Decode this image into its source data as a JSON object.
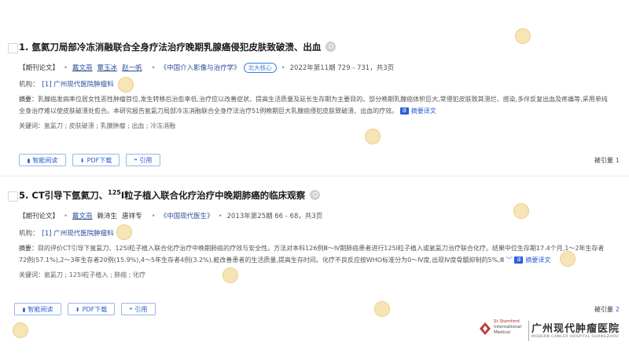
{
  "records": [
    {
      "title": "1. 氩氦刀局部冷冻消融联合全身疗法治疗晚期乳腺癌侵犯皮肤致破溃、出血",
      "type_tag": "【期刊论文】",
      "authors": [
        "戴文燕",
        "覃玉冰",
        "赵一帆"
      ],
      "journal": "《中国介入影像与治疗学》",
      "core_badge": "北大核心",
      "pub_info": "2022年第11期 729 - 731，共3页",
      "org_label": "机构：",
      "org_name": "[1] 广州现代医院肿瘤科",
      "abstract_label": "摘要：",
      "abstract_text": "乳腺癌发病率位居女性恶性肿瘤首位,发生转移后治愈率低,治疗应以改善症状、提高生活质量及延长生存期为主要目的。部分晚期乳腺癌体积巨大,常侵犯皮肤致其溃烂、感染,多伴反复出血及疼痛等,采用单纯全身治疗难以使皮肤破溃处愈合。本研究报告氩氦刀局部冷冻消融联合全身疗法治疗51例晚期巨大乳腺癌侵犯皮肤致破溃、出血的疗效。",
      "translate_label": "摘要译文",
      "keywords_label": "关键词：",
      "keywords": [
        "氩氦刀",
        "皮肤破溃",
        "乳腺肿瘤",
        "出血",
        "冷冻消融"
      ],
      "buttons": {
        "read": "智能阅读",
        "pdf": "PDF下载",
        "cite": "引用"
      },
      "cited_label": "被引量",
      "cited_count": "1"
    },
    {
      "title_pre": "5. CT引导下氩氦刀、",
      "title_sup": "125",
      "title_post": "I粒子植入联合化疗治疗中晚期肺癌的临床观察",
      "type_tag": "【期刊论文】",
      "authors": [
        "戴文燕",
        "赖沛生",
        "唐祥专"
      ],
      "journal": "《中国现代医生》",
      "pub_info": "2013年第25期 66 - 68，共3页",
      "org_label": "机构：",
      "org_name": "[1] 广州现代医院肿瘤科",
      "abstract_label": "摘要：",
      "abstract_text": "目的评价CT引导下氩氦刀、125I粒子植入联合化疗治疗中晚期肺癌的疗效与安全性。方法对本科126例Ⅲ～Ⅳ期肺癌患者进行125I粒子植入或氩氦刀治疗联合化疗。结果中位生存期17.4个月,1～2年生存者72例(57.1%),2～3年生存者20例(15.9%),4～5年生存者4例(3.2%),能改善患者的生活质量,提高生存时间。化疗不良反应按WHO标准分为0～Ⅳ度,出现Ⅳ度骨髓抑制的5%,Ⅲ",
      "translate_label": "摘要译文",
      "keywords_label": "关键词：",
      "keywords": [
        "氩氦刀",
        "125I粒子植入",
        "肺癌",
        "化疗"
      ],
      "buttons": {
        "read": "智能阅读",
        "pdf": "PDF下载",
        "cite": "引用"
      },
      "cited_label": "被引量",
      "cited_count": "2"
    }
  ],
  "logo": {
    "en_line1": "St Stamford",
    "en_line2": "International",
    "en_line3": "Medical",
    "cn_name": "广州现代肿瘤医院",
    "en_sub": "MODERN CANCER HOSPITAL GUANGZHOU"
  },
  "colors": {
    "link": "#2a4c9c",
    "accent": "#2a5bd7",
    "badge": "#3b7ce0"
  }
}
